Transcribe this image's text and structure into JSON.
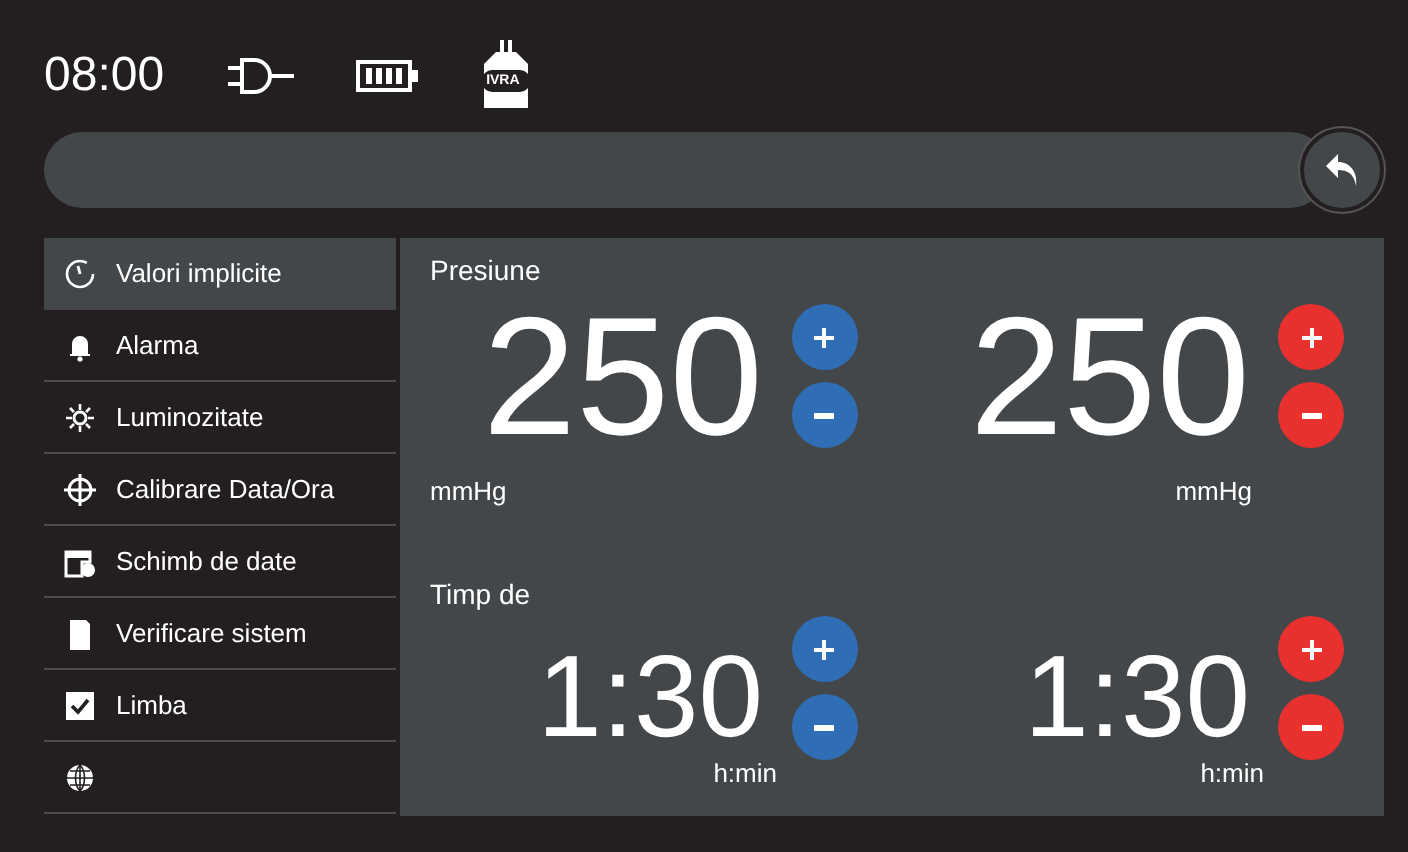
{
  "status_bar": {
    "time": "08:00",
    "bottle_label": "IVRA"
  },
  "sidebar": {
    "items": [
      {
        "label": "Valori implicite",
        "selected": true
      },
      {
        "label": "Alarma",
        "selected": false
      },
      {
        "label": "Luminozitate",
        "selected": false
      },
      {
        "label": "Calibrare Data/Ora",
        "selected": false
      },
      {
        "label": "Schimb de date",
        "selected": false
      },
      {
        "label": "Verificare sistem",
        "selected": false
      },
      {
        "label": "Limba",
        "selected": false
      },
      {
        "selected": false
      }
    ]
  },
  "sections": [
    {
      "kind": "pressure",
      "label": "Presiune",
      "values": [
        {
          "value": "250",
          "unit": "mmHg",
          "color": "#2f6db5"
        },
        {
          "value": "250",
          "unit": "mmHg",
          "color": "#e8312f"
        }
      ]
    },
    {
      "kind": "time",
      "label": "Timp de",
      "values": [
        {
          "value": "1:30",
          "unit": "h:min",
          "color": "#2f6db5"
        },
        {
          "value": "1:30",
          "unit": "h:min",
          "color": "#e8312f"
        }
      ]
    }
  ]
}
